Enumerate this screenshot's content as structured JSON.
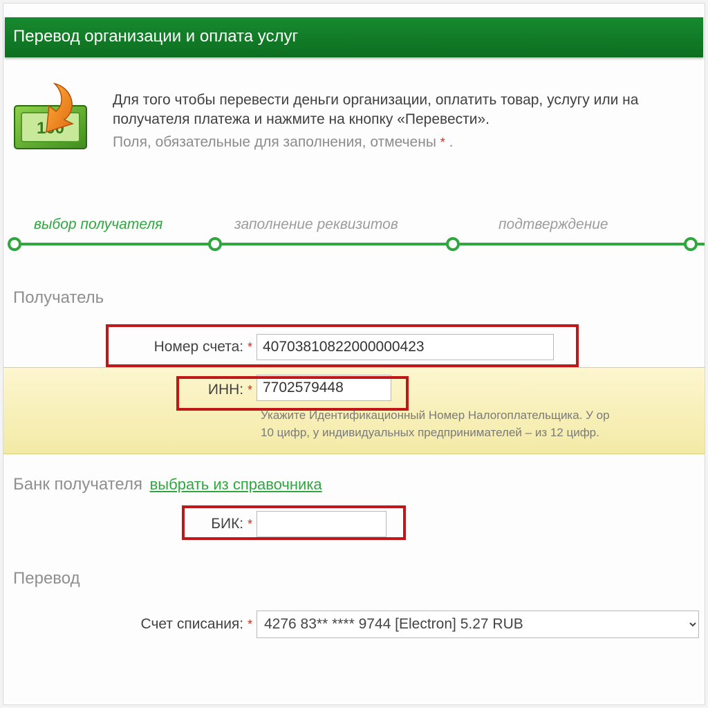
{
  "header": {
    "title": "Перевод организации и оплата услуг"
  },
  "intro": {
    "line1": "Для того чтобы перевести деньги организации, оплатить товар, услугу или на",
    "line2": "получателя платежа и нажмите на кнопку «Перевести».",
    "sub": "Поля, обязательные для заполнения, отмечены",
    "asterisk": "*",
    "dot": "."
  },
  "stepper": {
    "step1": "выбор получателя",
    "step2": "заполнение реквизитов",
    "step3": "подтверждение"
  },
  "sections": {
    "recipient": "Получатель",
    "bank": "Банк получателя",
    "bank_link": "выбрать из справочника",
    "transfer": "Перевод"
  },
  "fields": {
    "account": {
      "label": "Номер счета:",
      "value": "40703810822000000423"
    },
    "inn": {
      "label": "ИНН:",
      "value": "7702579448",
      "hint1": "Укажите Идентификационный Номер Налогоплательщика. У ор",
      "hint2": "10 цифр, у индивидуальных предпринимателей – из 12 цифр."
    },
    "bik": {
      "label": "БИК:",
      "value": ""
    },
    "debit": {
      "label": "Счет списания:",
      "value": "4276 83** **** 9744 [Electron] 5.27 RUB"
    }
  },
  "star": "*"
}
